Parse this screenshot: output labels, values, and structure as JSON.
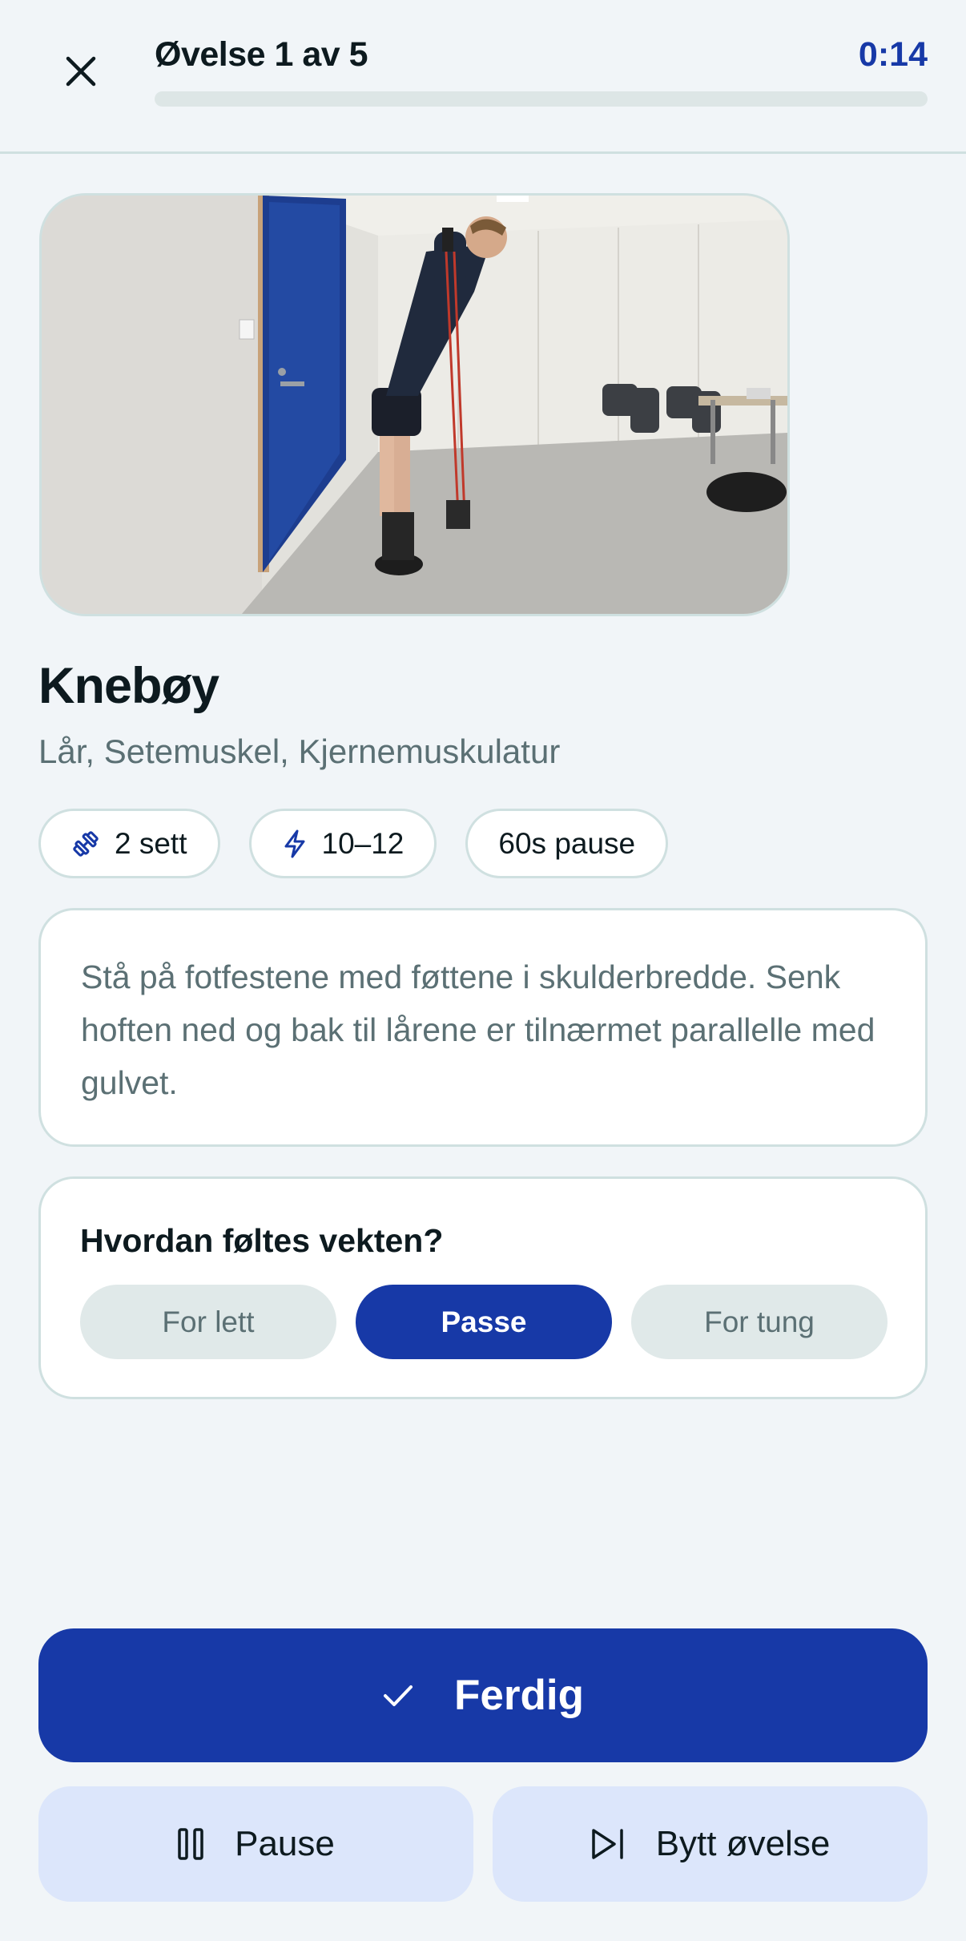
{
  "header": {
    "title": "Øvelse 1 av 5",
    "timer": "0:14",
    "progress": 0.0,
    "close_icon": "close-icon"
  },
  "exercise": {
    "name": "Knebøy",
    "muscles": "Lår, Setemuskel, Kjernemuskulatur",
    "chips": [
      {
        "icon": "dumbbell-icon",
        "label": "2 sett"
      },
      {
        "icon": "lightning-icon",
        "label": "10–12"
      },
      {
        "icon": "",
        "label": "60s pause"
      }
    ],
    "description": "Stå på fotfestene med føttene i skulderbredde. Senk hoften ned og bak til lårene er tilnærmet parallelle med gulvet."
  },
  "weight_feedback": {
    "question": "Hvordan føltes vekten?",
    "options": [
      "For lett",
      "Passe",
      "For tung"
    ],
    "selected": "Passe"
  },
  "actions": {
    "done_label": "Ferdig",
    "pause_label": "Pause",
    "swap_label": "Bytt øvelse"
  },
  "colors": {
    "accent": "#1739a7",
    "background": "#f1f5f8",
    "muted_text": "#5b7074",
    "border": "#cfe0e0",
    "secondary_button": "#dce6fb"
  }
}
